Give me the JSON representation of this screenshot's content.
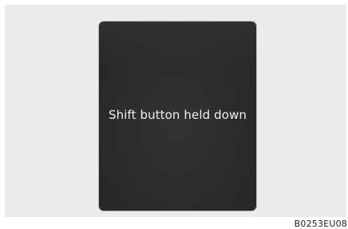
{
  "display": {
    "message": "Shift button held down"
  },
  "figure": {
    "reference_code": "B0253EU08"
  }
}
